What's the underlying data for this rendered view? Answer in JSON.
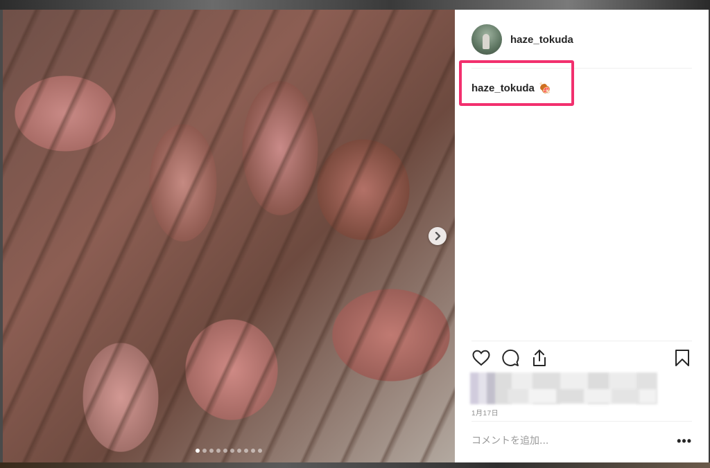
{
  "post": {
    "username": "haze_tokuda",
    "caption_author": "haze_tokuda",
    "caption_emoji": "🍖",
    "date": "1月17日",
    "carousel": {
      "slide_count": 10,
      "active_slide": 1
    }
  },
  "comment": {
    "placeholder": "コメントを追加...",
    "more_label": "•••"
  },
  "colors": {
    "highlight_border": "#f2306e",
    "text_primary": "#262626",
    "text_secondary": "#8e8e8e"
  },
  "icons": [
    "heart-icon",
    "comment-icon",
    "share-icon",
    "bookmark-icon",
    "chevron-right-icon"
  ]
}
